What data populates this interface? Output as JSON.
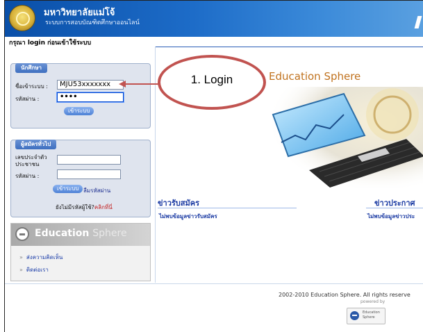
{
  "header": {
    "university_name": "มหาวิทยาลัยแม่โจ้",
    "system_name": "ระบบการสอบบัณฑิตศึกษาออนไลน์",
    "notice": "กรุณา login ก่อนเข้าใช้ระบบ"
  },
  "student_login": {
    "tab_label": "นักศึกษา",
    "username_label": "ชื่อเข้าระบบ :",
    "username_value": "MJU53xxxxxxx",
    "password_label": "รหัสผ่าน :",
    "password_value": "••••",
    "submit_label": "เข้าระบบ"
  },
  "applicant_login": {
    "tab_label": "ผู้สมัครทั่วไป",
    "id_label": "เลขประจำตัว ประชาชน",
    "id_value": "",
    "password_label": "รหัสผ่าน :",
    "password_value": "",
    "submit_label": "เข้าระบบ",
    "forgot_label": "ลืมรหัสผ่าน",
    "register_text": "ยังไม่มีรหัสผู้ใช้?",
    "register_link": "คลิกที่นี่"
  },
  "education_sphere_box": {
    "title_main": "Education",
    "title_sub": "Sphere",
    "links": [
      "ส่งความคิดเห็น",
      "ติดต่อเรา"
    ]
  },
  "main": {
    "brand_title": "Education Sphere",
    "news_left_title": "ข่าวรับสมัคร",
    "news_left_item": "ไม่พบข้อมูลข่าวรับสมัคร",
    "news_right_title": "ข่าวประกาศ",
    "news_right_item": "ไม่พบข้อมูลข่าวประ"
  },
  "footer": {
    "copyright": "2002-2010 Education Sphere. All rights reserve",
    "powered_by": "powered by",
    "badge_line1": "Education",
    "badge_line2": "Sphere"
  },
  "annotation": {
    "callout_text": "1. Login",
    "color": "#c15350"
  },
  "colors": {
    "header_blue": "#1d6cc8",
    "link_blue": "#1a3aa3",
    "accent_orange": "#c0721e"
  }
}
